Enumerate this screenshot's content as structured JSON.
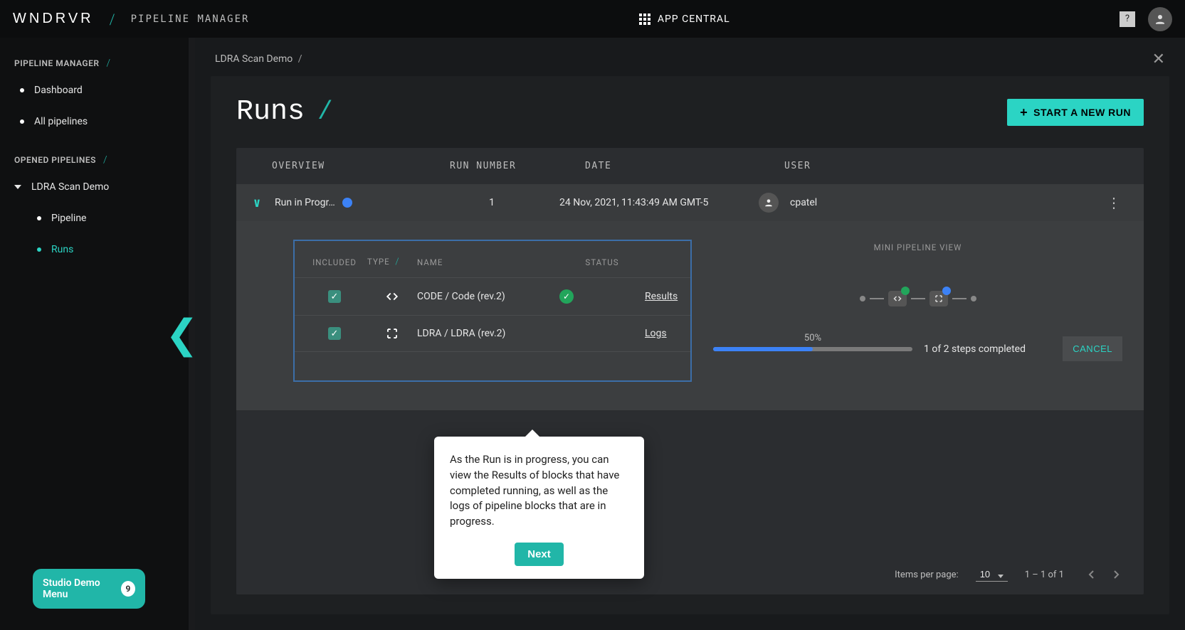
{
  "topbar": {
    "logo": "WNDRVR",
    "app_title": "PIPELINE MANAGER",
    "center_label": "APP CENTRAL",
    "help": "?"
  },
  "sidebar": {
    "section1_title": "PIPELINE MANAGER",
    "items1": [
      {
        "label": "Dashboard"
      },
      {
        "label": "All pipelines"
      }
    ],
    "section2_title": "OPENED PIPELINES",
    "group_label": "LDRA Scan Demo",
    "items2": [
      {
        "label": "Pipeline",
        "active": false
      },
      {
        "label": "Runs",
        "active": true
      }
    ],
    "demo_menu_label": "Studio Demo Menu",
    "demo_menu_count": "9"
  },
  "breadcrumb": {
    "item": "LDRA Scan Demo",
    "sep": "/"
  },
  "page": {
    "title": "Runs",
    "new_run_btn": "START A NEW RUN"
  },
  "table": {
    "headers": {
      "overview": "OVERVIEW",
      "run_number": "RUN NUMBER",
      "date": "DATE",
      "user": "USER"
    },
    "row": {
      "name": "Run in Progr…",
      "number": "1",
      "date": "24 Nov, 2021, 11:43:49 AM GMT-5",
      "user": "cpatel"
    },
    "expanded": {
      "headers": {
        "included": "INCLUDED",
        "type": "TYPE",
        "name": "NAME",
        "status": "STATUS"
      },
      "rows": [
        {
          "name": "CODE / Code (rev.2)",
          "status": "success",
          "action": "Results"
        },
        {
          "name": "LDRA / LDRA (rev.2)",
          "status": "running",
          "action": "Logs"
        }
      ],
      "mini_title": "MINI PIPELINE VIEW",
      "progress_pct": "50%",
      "progress_text": "1 of 2 steps completed",
      "cancel": "CANCEL"
    },
    "pager": {
      "label": "Items per page:",
      "page_size": "10",
      "range": "1 – 1 of 1"
    }
  },
  "popover": {
    "text": "As the Run is in progress, you can view the Results of blocks that have completed running, as well as the logs of pipeline blocks that are in progress.",
    "next": "Next"
  }
}
